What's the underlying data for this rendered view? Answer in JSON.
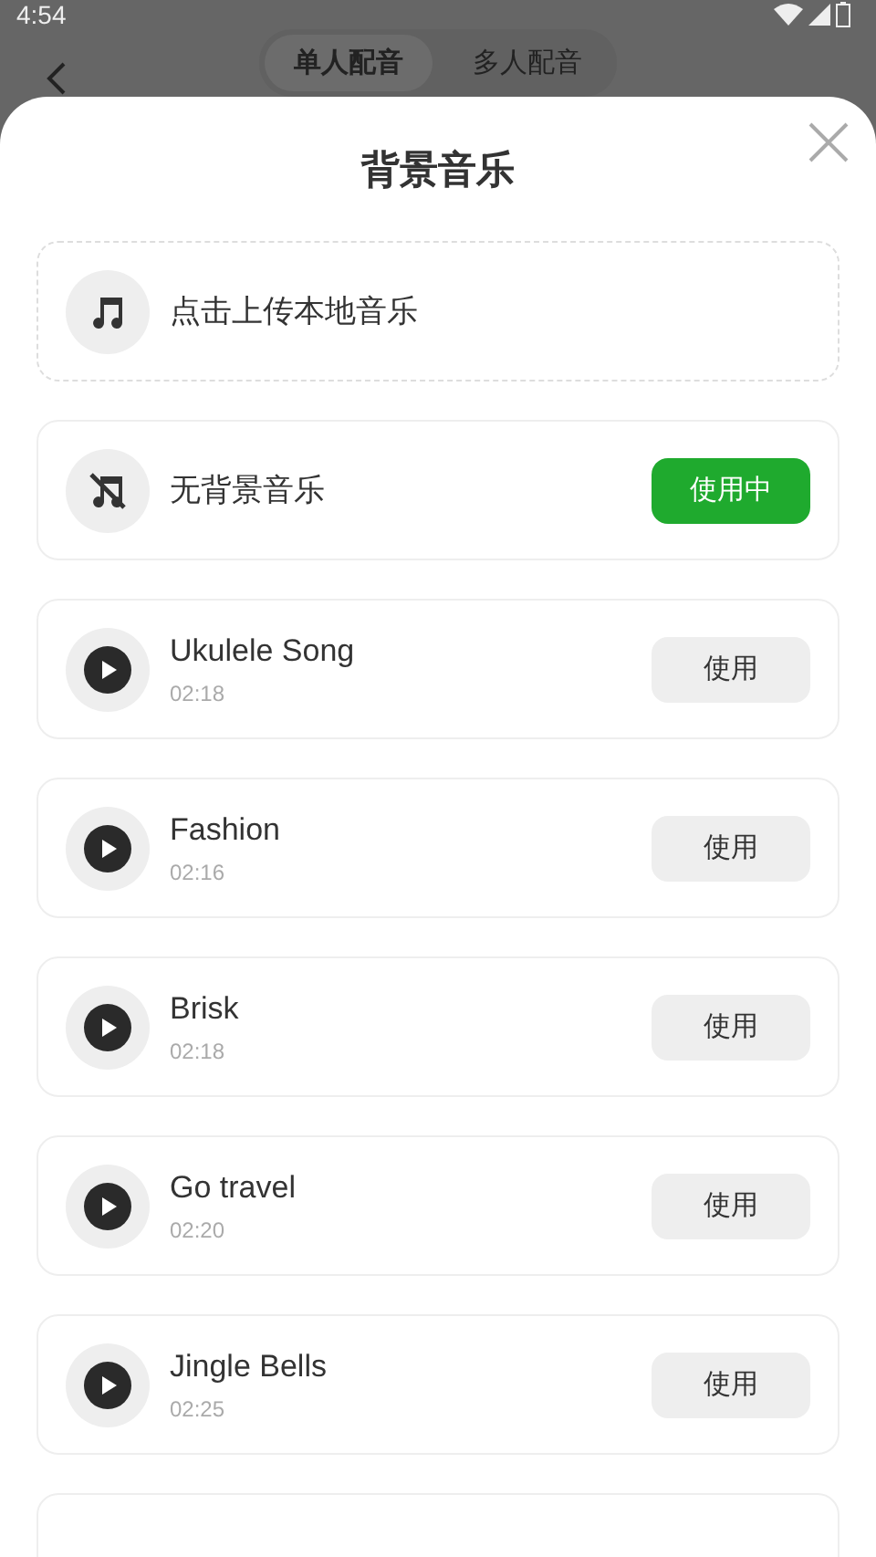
{
  "status_bar": {
    "time": "4:54"
  },
  "header": {
    "tabs": [
      {
        "label": "单人配音",
        "selected": true
      },
      {
        "label": "多人配音",
        "selected": false
      }
    ]
  },
  "sheet": {
    "title": "背景音乐",
    "upload": {
      "label": "点击上传本地音乐"
    },
    "items": [
      {
        "kind": "none",
        "title": "无背景音乐",
        "button": "使用中",
        "selected": true
      },
      {
        "kind": "track",
        "title": "Ukulele Song",
        "duration": "02:18",
        "button": "使用",
        "selected": false
      },
      {
        "kind": "track",
        "title": "Fashion",
        "duration": "02:16",
        "button": "使用",
        "selected": false
      },
      {
        "kind": "track",
        "title": "Brisk",
        "duration": "02:18",
        "button": "使用",
        "selected": false
      },
      {
        "kind": "track",
        "title": "Go travel",
        "duration": "02:20",
        "button": "使用",
        "selected": false
      },
      {
        "kind": "track",
        "title": "Jingle Bells",
        "duration": "02:25",
        "button": "使用",
        "selected": false
      }
    ]
  }
}
